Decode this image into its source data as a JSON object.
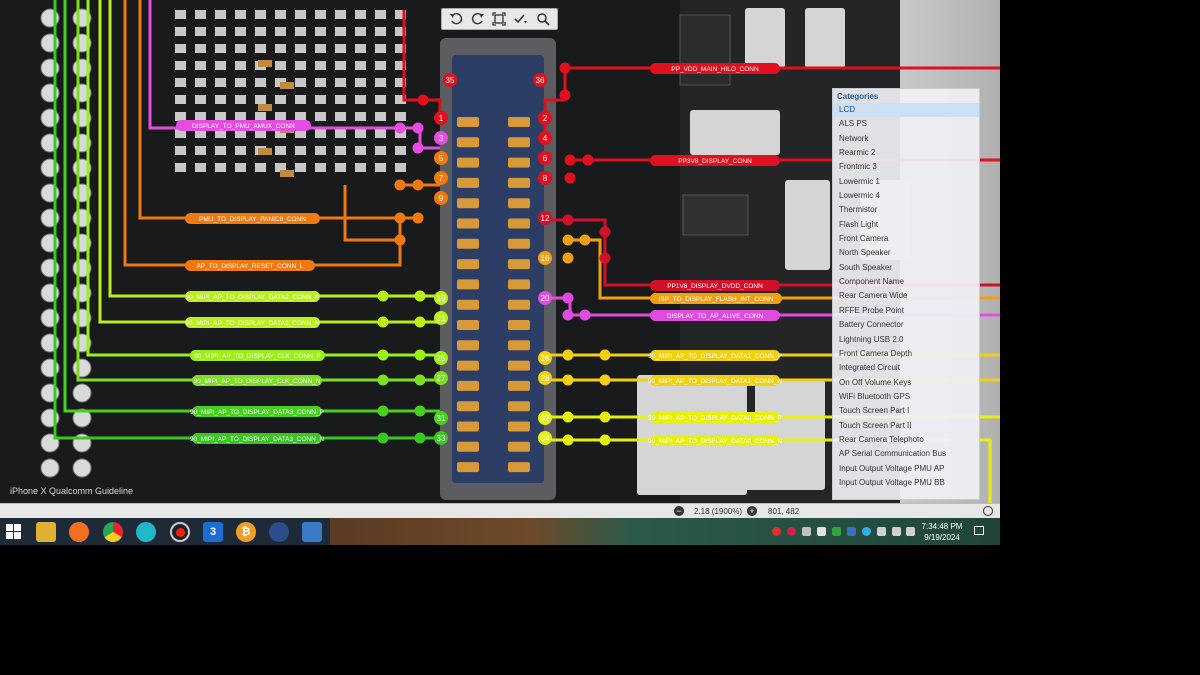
{
  "window": {
    "watermark": "iPhone X Qualcomm Guideline"
  },
  "toolbar": {
    "buttons": [
      "rotate-left-icon",
      "rotate-right-icon",
      "fit-screen-icon",
      "checkmark-dropdown-icon",
      "magnifier-icon"
    ]
  },
  "pin_labels": {
    "left": [
      "1",
      "3",
      "5",
      "7",
      "9",
      "19",
      "21",
      "25",
      "27",
      "31",
      "33",
      "35"
    ],
    "right": [
      "2",
      "4",
      "6",
      "8",
      "12",
      "16",
      "20",
      "26",
      "28",
      "32",
      "34",
      "36"
    ]
  },
  "net_labels": [
    {
      "text": "PP_VDD_MAIN_HILO_CONN",
      "color": "#e0101e"
    },
    {
      "text": "DISPLAY_TO_PMU_AMUX_CONN",
      "color": "#e64ce0"
    },
    {
      "text": "PP3V8_DISPLAY_CONN",
      "color": "#e0101e"
    },
    {
      "text": "PMU_TO_DISPLAY_PANIC8_CONN",
      "color": "#f07a10"
    },
    {
      "text": "AP_TO_DISPLAY_RESET_CONN_L",
      "color": "#f07a10"
    },
    {
      "text": "PP1V8_DISPLAY_DVDD_CONN",
      "color": "#d1102a"
    },
    {
      "text": "ISP_TO_DISPLAY_FLASH_INT_CONN",
      "color": "#f0a010"
    },
    {
      "text": "DISPLAY_TO_AP_ALIVE_CONN",
      "color": "#e04ce0"
    },
    {
      "text": "90_MIPI_AP_TO_DISPLAY_DATA2_CONN_P",
      "color": "#b9f018"
    },
    {
      "text": "90_MIPI_AP_TO_DISPLAY_DATA2_CONN_N",
      "color": "#b9f018"
    },
    {
      "text": "90_MIPI_AP_TO_DISPLAY_CLK_CONN_P",
      "color": "#9cf018"
    },
    {
      "text": "90_MIPI_AP_TO_DISPLAY_CLK_CONN_N",
      "color": "#7ce020"
    },
    {
      "text": "90_MIPI_AP_TO_DISPLAY_DATA3_CONN_P",
      "color": "#48d020"
    },
    {
      "text": "90_MIPI_AP_TO_DISPLAY_DATA3_CONN_N",
      "color": "#38c820"
    },
    {
      "text": "90_MIPI_AP_TO_DISPLAY_DATA1_CONN_P",
      "color": "#f0d010"
    },
    {
      "text": "90_MIPI_AP_TO_DISPLAY_DATA1_CONN_N",
      "color": "#f0d010"
    },
    {
      "text": "90_MIPI_AP_TO_DISPLAY_DATA0_CONN_P",
      "color": "#e6f010"
    },
    {
      "text": "90_MIPI_AP_TO_DISPLAY_DATA0_CONN_N",
      "color": "#e6f010"
    }
  ],
  "categories": {
    "title": "Categories",
    "items": [
      "LCD",
      "ALS PS",
      "Network",
      "Rearmic 2",
      "Frontmic 3",
      "Lowermic 1",
      "Lowermic 4",
      "Thermistor",
      "Flash Light",
      "Front Camera",
      "North Speaker",
      "South Speaker",
      "Component Name",
      "Rear Camera Wide",
      "RFFE Probe Point",
      "Battery Connector",
      "Lightning USB 2.0",
      "Front Camera Depth",
      "Integrated Circuit",
      "On Off Volume Keys",
      "WiFi Bluetooth GPS",
      "Touch Screen Part I",
      "Touch Screen Part II",
      "Rear Camera Telephoto",
      "AP Serial Communication Bus",
      "Input Output Voltage PMU AP",
      "Input Output Voltage PMU BB"
    ],
    "selected": "LCD"
  },
  "statusbar": {
    "zoom": "2.18 (1900%)",
    "coords": "801, 482"
  },
  "taskbar": {
    "apps": [
      "file-explorer-icon",
      "firefox-icon",
      "chrome-icon",
      "teal-app-icon",
      "record-icon",
      "number-3-app-icon",
      "bitcoin-app-icon",
      "browser-app-icon",
      "active-app-icon"
    ],
    "time": "7:34:48 PM",
    "date": "9/19/2024"
  }
}
